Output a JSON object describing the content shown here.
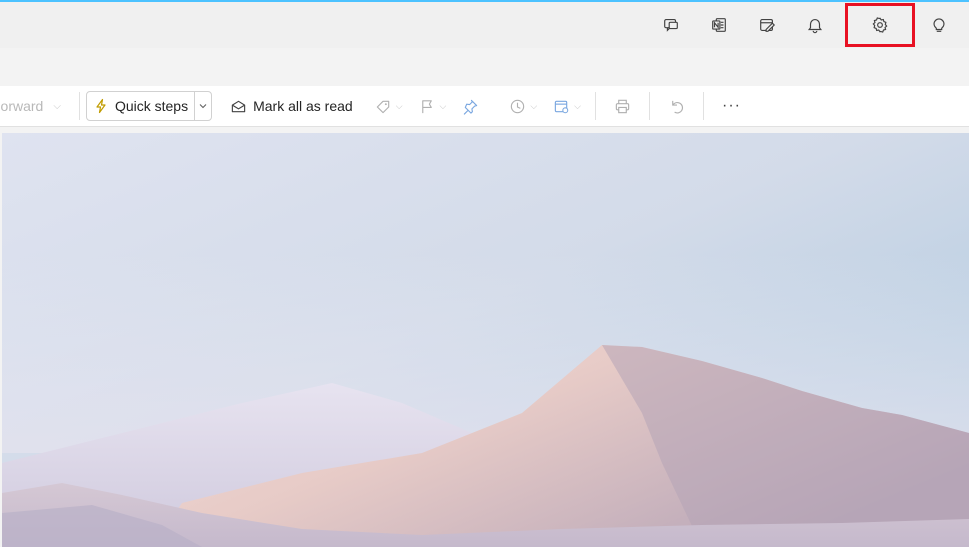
{
  "toolbar": {
    "forward_label": "Forward",
    "quick_steps_label": "Quick steps",
    "mark_all_read_label": "Mark all as read",
    "more_label": "···"
  },
  "title_actions": [
    {
      "name": "feedback-icon"
    },
    {
      "name": "onenote-icon"
    },
    {
      "name": "my-day-icon"
    },
    {
      "name": "bell-icon"
    },
    {
      "name": "gear-icon"
    },
    {
      "name": "lightbulb-icon"
    }
  ],
  "colors": {
    "accent_line": "#4cc2ff",
    "highlight_box": "#e81123",
    "title_bar": "#f0f0f0"
  },
  "reading_pane": {
    "background_image": "mountain-landscape"
  }
}
